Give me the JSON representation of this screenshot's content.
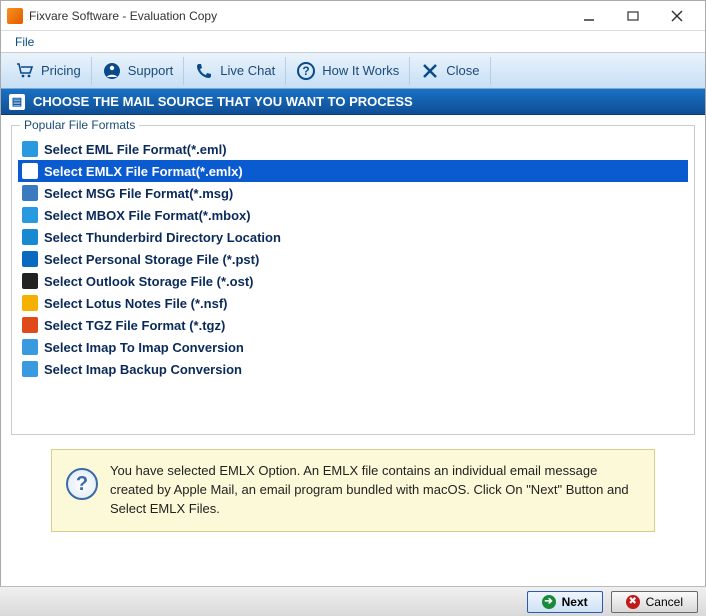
{
  "titlebar": {
    "title": "Fixvare Software - Evaluation Copy"
  },
  "menubar": {
    "file": "File"
  },
  "toolbar": {
    "pricing": "Pricing",
    "support": "Support",
    "livechat": "Live Chat",
    "howitworks": "How It Works",
    "close": "Close"
  },
  "header": {
    "title": "CHOOSE THE MAIL SOURCE THAT YOU WANT TO PROCESS"
  },
  "group": {
    "label": "Popular File Formats"
  },
  "formats": [
    {
      "label": "Select EML File Format(*.eml)",
      "icon_bg": "#2a9ae0"
    },
    {
      "label": "Select EMLX File Format(*.emlx)",
      "icon_bg": "#ffffff",
      "selected": true
    },
    {
      "label": "Select MSG File Format(*.msg)",
      "icon_bg": "#3a7ac0"
    },
    {
      "label": "Select MBOX File Format(*.mbox)",
      "icon_bg": "#2a9ae0"
    },
    {
      "label": "Select Thunderbird Directory Location",
      "icon_bg": "#1a8ad0"
    },
    {
      "label": "Select Personal Storage File (*.pst)",
      "icon_bg": "#0a6ac0"
    },
    {
      "label": "Select Outlook Storage File (*.ost)",
      "icon_bg": "#222222"
    },
    {
      "label": "Select Lotus Notes File (*.nsf)",
      "icon_bg": "#f5b000"
    },
    {
      "label": "Select TGZ File Format (*.tgz)",
      "icon_bg": "#e04a1a"
    },
    {
      "label": "Select Imap To Imap Conversion",
      "icon_bg": "#3a9ae0"
    },
    {
      "label": "Select Imap Backup Conversion",
      "icon_bg": "#3a9ae0"
    }
  ],
  "info": {
    "message": "You have selected EMLX Option. An EMLX file contains an individual email message created by Apple Mail, an email program bundled with macOS. Click On \"Next\" Button and Select EMLX Files."
  },
  "footer": {
    "next": "Next",
    "cancel": "Cancel"
  }
}
